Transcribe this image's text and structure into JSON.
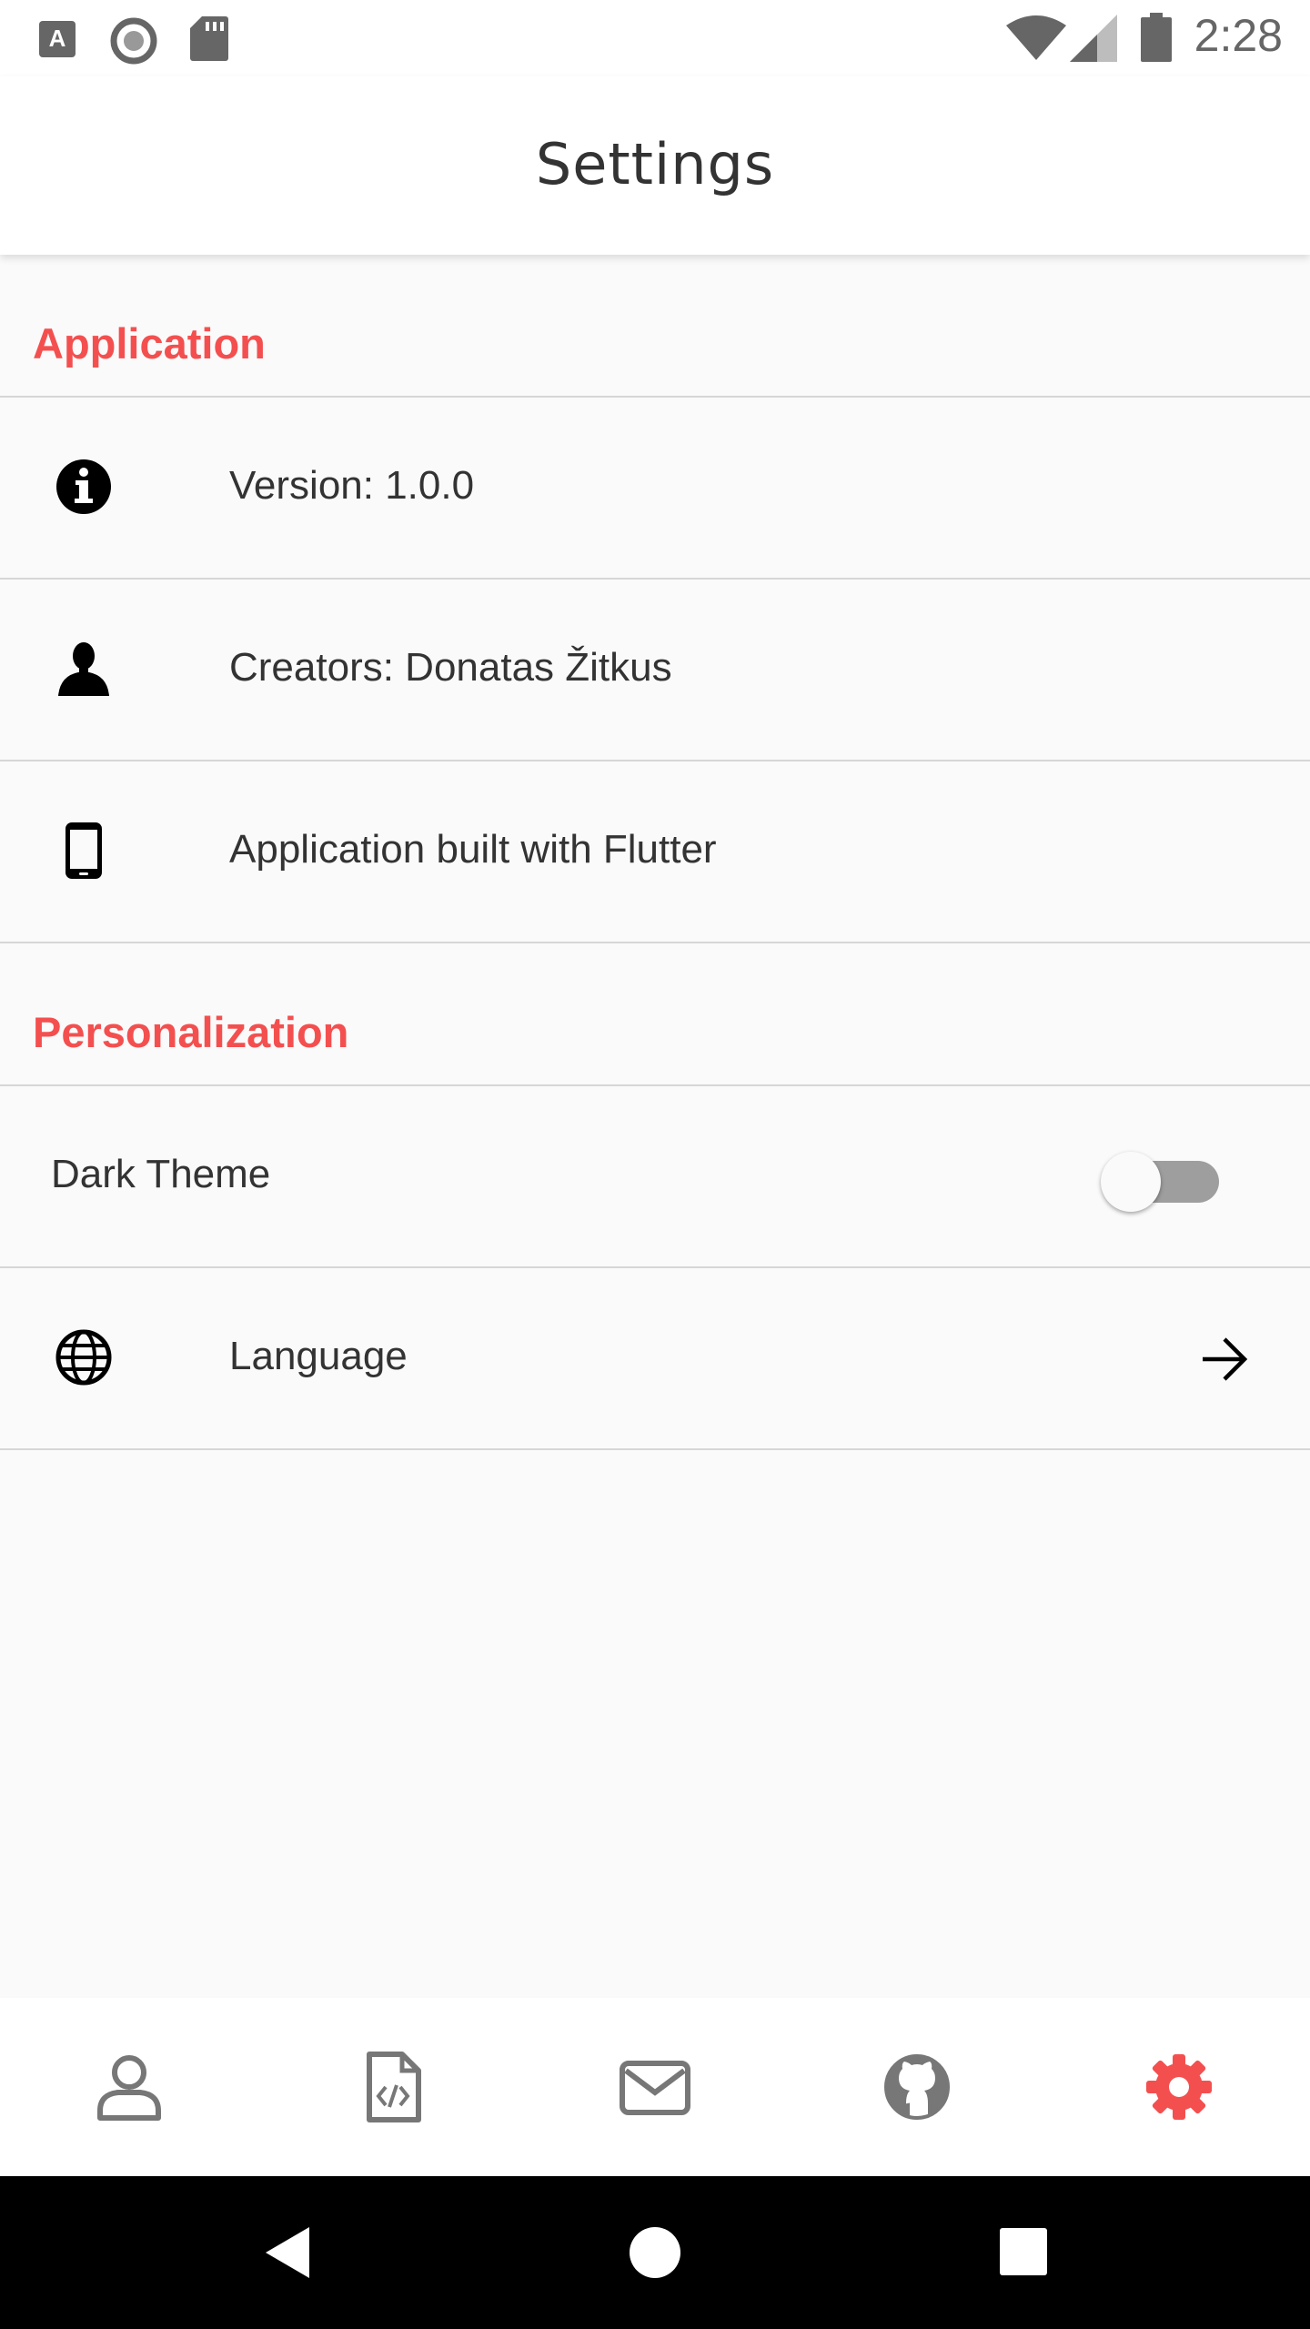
{
  "status_bar": {
    "time": "2:28",
    "icons": [
      "keyboard-a-icon",
      "sync-circle-icon",
      "sd-card-icon",
      "wifi-icon",
      "cell-signal-icon",
      "battery-icon"
    ]
  },
  "app_bar": {
    "title": "Settings"
  },
  "sections": {
    "application": {
      "label": "Application",
      "items": [
        {
          "label": "Version: 1.0.0",
          "icon": "info-icon"
        },
        {
          "label": "Creators: Donatas Žitkus",
          "icon": "person-icon"
        },
        {
          "label": "Application built with Flutter",
          "icon": "phone-icon"
        }
      ]
    },
    "personalization": {
      "label": "Personalization",
      "dark_theme": {
        "label": "Dark Theme",
        "enabled": false
      },
      "language": {
        "label": "Language",
        "icon": "globe-icon",
        "trailing_icon": "arrow-right-icon"
      }
    }
  },
  "bottom_nav": {
    "items": [
      {
        "icon": "profile-icon",
        "active": false
      },
      {
        "icon": "code-file-icon",
        "active": false
      },
      {
        "icon": "mail-icon",
        "active": false
      },
      {
        "icon": "github-icon",
        "active": false
      },
      {
        "icon": "settings-gear-icon",
        "active": true
      }
    ],
    "active_color": "#f44f4f",
    "inactive_color": "#777777"
  },
  "system_nav": {
    "buttons": [
      "back-icon",
      "home-icon",
      "recents-icon"
    ]
  },
  "colors": {
    "accent": "#f44f4f",
    "background": "#fafafa",
    "divider": "#d6d6d6"
  }
}
